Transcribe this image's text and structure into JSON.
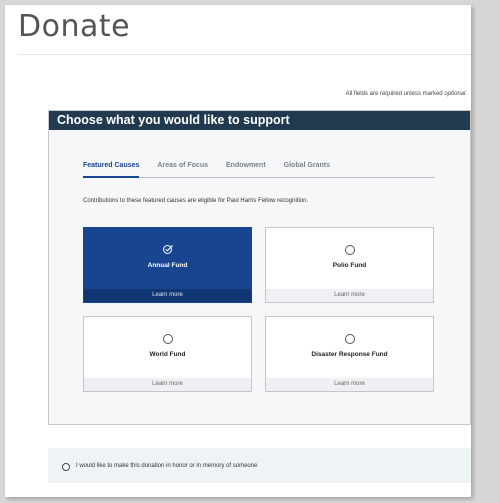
{
  "page": {
    "title": "Donate",
    "required_note": "All fields are required unless marked",
    "required_note_optional": "optional."
  },
  "card": {
    "header": "Choose what you would like to support",
    "tabs": [
      {
        "label": "Featured Causes",
        "active": true
      },
      {
        "label": "Areas of Focus",
        "active": false
      },
      {
        "label": "Endowment",
        "active": false
      },
      {
        "label": "Global Grants",
        "active": false
      }
    ],
    "intro": "Contributions to these featured causes are eligible for Paul Harris Fellow recognition.",
    "funds": [
      {
        "name": "Annual Fund",
        "link": "Learn more",
        "selected": true
      },
      {
        "name": "Polio Fund",
        "link": "Learn more",
        "selected": false
      },
      {
        "name": "World Fund",
        "link": "Learn more",
        "selected": false
      },
      {
        "name": "Disaster Response Fund",
        "link": "Learn more",
        "selected": false
      }
    ]
  },
  "honor": {
    "label": "I would like to make this donation in honor or in memory of someone",
    "checked": false
  },
  "colors": {
    "brand_blue": "#17458f",
    "header_navy": "#213a4f"
  },
  "icons": {
    "selected_fund": "check-circle-icon",
    "unselected_fund": "radio-empty-icon"
  }
}
